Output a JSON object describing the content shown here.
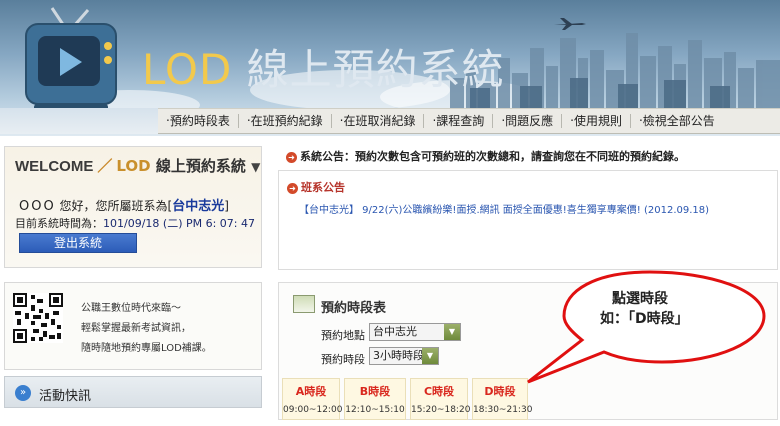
{
  "banner": {
    "title_lod": "LOD",
    "title_rest": "線上預約系統"
  },
  "nav": {
    "items": [
      "‧預約時段表",
      "‧在班預約紀錄",
      "‧在班取消紀錄",
      "‧課程查詢",
      "‧問題反應",
      "‧使用規則",
      "‧檢視全部公告"
    ]
  },
  "welcome": {
    "welcome_word": "WELCOME",
    "slash": "／",
    "lod": "LOD",
    "system_name": "線上預約系統",
    "dropdown_glyph": "▼",
    "user_name": "OOO",
    "greeting": " 您好，您所屬班系為[",
    "branch": "台中志光",
    "greeting_end": "]",
    "time_label": "目前系統時間為：",
    "time_value": "101/09/18 (二) PM 6: 07: 47",
    "logout_label": "登出系統"
  },
  "promo": {
    "lines": [
      "公職王數位時代來臨～",
      "輕鬆掌握最新考試資訊，",
      "隨時隨地預約專屬LOD補課。"
    ]
  },
  "activity": {
    "icon": "chevron-icon",
    "label": "活動快訊"
  },
  "announcement": {
    "text": "系統公告：預約次數包含可預約班的次數總和，請查詢您在不同班的預約紀錄。"
  },
  "class_news": {
    "title": "班系公告",
    "item": "【台中志光】 9/22(六)公職繽紛樂!面授.網訊 面授全面優惠!喜生獨享專案價! (2012.09.18)"
  },
  "schedule": {
    "title": "預約時段表",
    "location_label": "預約地點",
    "location_value": "台中志光",
    "period_label": "預約時段",
    "period_value": "3小時時段",
    "slots": [
      {
        "label": "A時段",
        "range": "09:00~12:00"
      },
      {
        "label": "B時段",
        "range": "12:10~15:10"
      },
      {
        "label": "C時段",
        "range": "15:20~18:20"
      },
      {
        "label": "D時段",
        "range": "18:30~21:30"
      }
    ]
  },
  "callout": {
    "line1": "點選時段",
    "line2": "如：「D時段」"
  },
  "colors": {
    "accent_red": "#d9281e",
    "button_blue": "#2c5cb8",
    "slot_bg": "#fef8e2",
    "callout_red": "#e01010"
  }
}
